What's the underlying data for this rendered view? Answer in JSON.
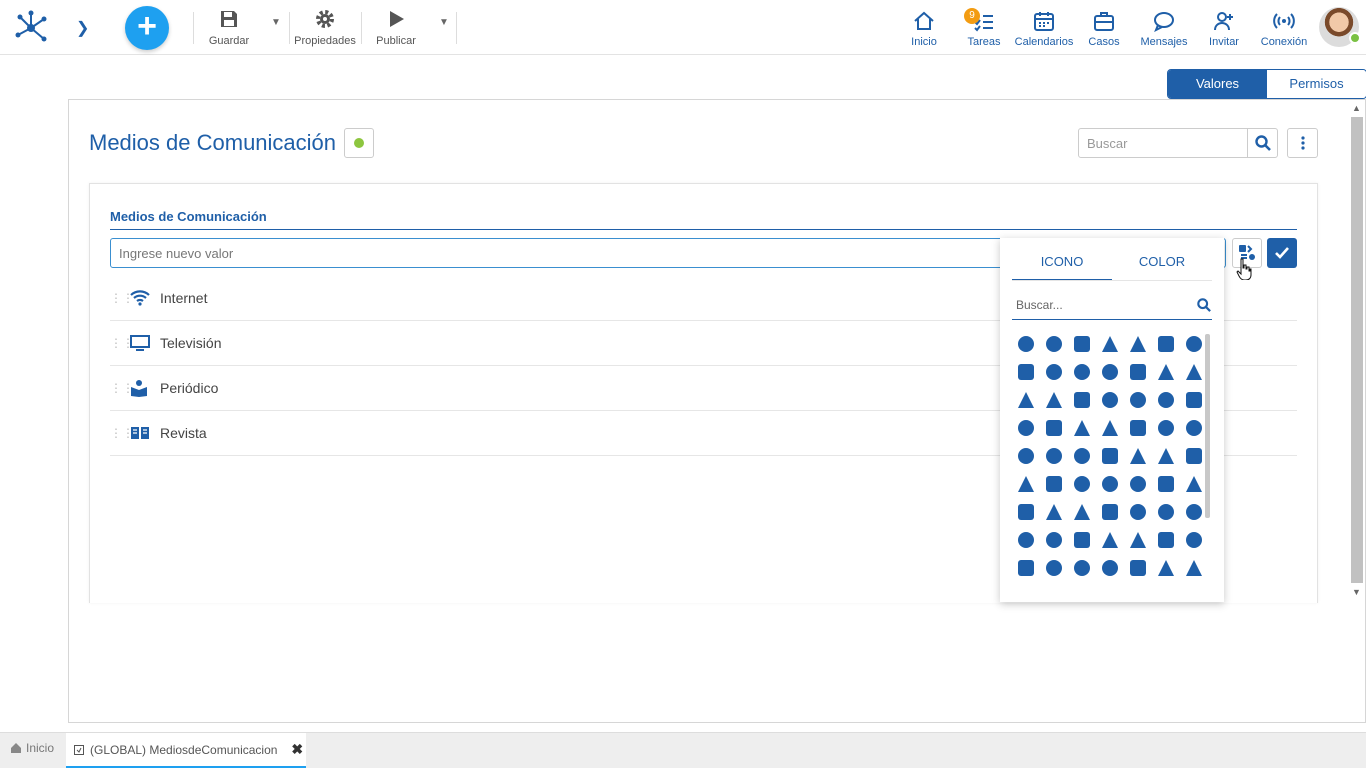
{
  "toolbar": {
    "save_label": "Guardar",
    "properties_label": "Propiedades",
    "publish_label": "Publicar",
    "expand_icon": "chevron-right-icon",
    "add_icon": "plus-icon"
  },
  "nav": {
    "home": "Inicio",
    "tasks": "Tareas",
    "tasks_badge": "9",
    "calendars": "Calendarios",
    "cases": "Casos",
    "messages": "Mensajes",
    "invite": "Invitar",
    "connection": "Conexión"
  },
  "view_tabs": {
    "values": "Valores",
    "permissions": "Permisos",
    "active": "Valores"
  },
  "page": {
    "title": "Medios de Comunicación",
    "search_placeholder": "Buscar",
    "status_color": "#8dc63f"
  },
  "section": {
    "title": "Medios de Comunicación",
    "new_value_placeholder": "Ingrese nuevo valor"
  },
  "items": [
    {
      "name": "Internet",
      "icon": "wifi-icon"
    },
    {
      "name": "Televisión",
      "icon": "monitor-icon"
    },
    {
      "name": "Periódico",
      "icon": "newspaper-reader-icon"
    },
    {
      "name": "Revista",
      "icon": "book-open-icon"
    }
  ],
  "picker": {
    "tab_icon": "ICONO",
    "tab_color": "COLOR",
    "active_tab": "ICONO",
    "search_placeholder": "Buscar..."
  },
  "bottom_tabs": {
    "home": "Inicio",
    "document": "(GLOBAL) MediosdeComunicacion"
  },
  "colors": {
    "primary": "#1f5fa8",
    "accent": "#1ea0f0",
    "badge": "#f39c12"
  }
}
